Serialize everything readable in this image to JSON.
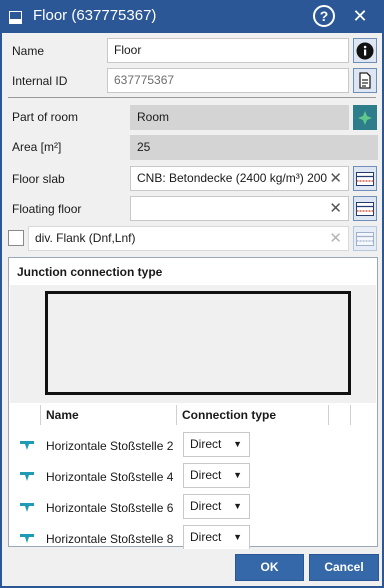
{
  "window": {
    "title": "Floor (637775367)",
    "help_symbol": "?",
    "close_symbol": "✕"
  },
  "form": {
    "name": {
      "label": "Name",
      "value": "Floor"
    },
    "internal_id": {
      "label": "Internal ID",
      "value": "637775367"
    },
    "part_of_room": {
      "label": "Part of room",
      "value": "Room"
    },
    "area": {
      "label": "Area [m²]",
      "value": "25"
    },
    "floor_slab": {
      "label": "Floor slab",
      "value": "CNB: Betondecke (2400 kg/m³) 200"
    },
    "floating_floor": {
      "label": "Floating floor",
      "value": ""
    },
    "flank": {
      "label": "div. Flank (Dnf,Lnf)",
      "value": "",
      "checked": false
    },
    "clear_symbol": "✕"
  },
  "junction": {
    "title": "Junction connection type",
    "columns": {
      "name": "Name",
      "connection_type": "Connection type"
    },
    "rows": [
      {
        "name": "Horizontale Stoßstelle 2",
        "type": "Direct"
      },
      {
        "name": "Horizontale Stoßstelle 4",
        "type": "Direct"
      },
      {
        "name": "Horizontale Stoßstelle 6",
        "type": "Direct"
      },
      {
        "name": "Horizontale Stoßstelle 8",
        "type": "Direct"
      }
    ],
    "dropdown_arrow": "▼"
  },
  "footer": {
    "ok_label": "OK",
    "cancel_label": "Cancel"
  },
  "colors": {
    "titlebar": "#2b5797",
    "primary_button": "#3568a8",
    "accent_green": "#2e7d8a",
    "junction_icon": "#1f9bb5"
  },
  "icons": [
    "floor-app-icon",
    "help-icon",
    "close-icon",
    "info-icon",
    "copy-icon",
    "pick-room-icon",
    "material-icon",
    "clear-icon",
    "junction-icon",
    "dropdown-arrow-icon"
  ]
}
